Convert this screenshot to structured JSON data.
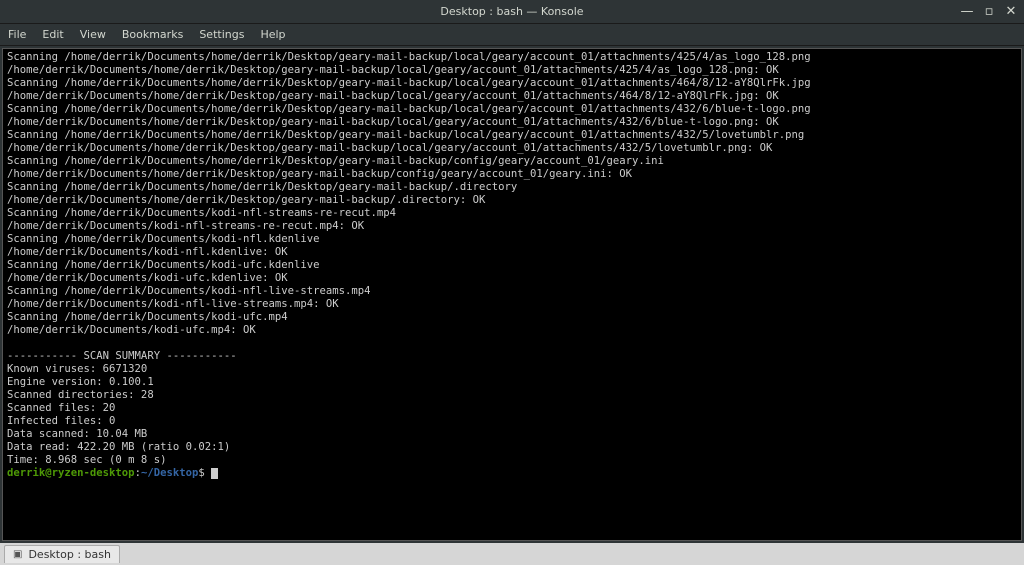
{
  "titlebar": {
    "title": "Desktop : bash — Konsole"
  },
  "window_controls": {
    "minimize": "—",
    "maximize": "▫",
    "close": "✕"
  },
  "menu": {
    "file": "File",
    "edit": "Edit",
    "view": "View",
    "bookmarks": "Bookmarks",
    "settings": "Settings",
    "help": "Help"
  },
  "terminal": {
    "lines": [
      "Scanning /home/derrik/Documents/home/derrik/Desktop/geary-mail-backup/local/geary/account_01/attachments/425/4/as_logo_128.png",
      "/home/derrik/Documents/home/derrik/Desktop/geary-mail-backup/local/geary/account_01/attachments/425/4/as_logo_128.png: OK",
      "Scanning /home/derrik/Documents/home/derrik/Desktop/geary-mail-backup/local/geary/account_01/attachments/464/8/12-aY8QlrFk.jpg",
      "/home/derrik/Documents/home/derrik/Desktop/geary-mail-backup/local/geary/account_01/attachments/464/8/12-aY8QlrFk.jpg: OK",
      "Scanning /home/derrik/Documents/home/derrik/Desktop/geary-mail-backup/local/geary/account_01/attachments/432/6/blue-t-logo.png",
      "/home/derrik/Documents/home/derrik/Desktop/geary-mail-backup/local/geary/account_01/attachments/432/6/blue-t-logo.png: OK",
      "Scanning /home/derrik/Documents/home/derrik/Desktop/geary-mail-backup/local/geary/account_01/attachments/432/5/lovetumblr.png",
      "/home/derrik/Documents/home/derrik/Desktop/geary-mail-backup/local/geary/account_01/attachments/432/5/lovetumblr.png: OK",
      "Scanning /home/derrik/Documents/home/derrik/Desktop/geary-mail-backup/config/geary/account_01/geary.ini",
      "/home/derrik/Documents/home/derrik/Desktop/geary-mail-backup/config/geary/account_01/geary.ini: OK",
      "Scanning /home/derrik/Documents/home/derrik/Desktop/geary-mail-backup/.directory",
      "/home/derrik/Documents/home/derrik/Desktop/geary-mail-backup/.directory: OK",
      "Scanning /home/derrik/Documents/kodi-nfl-streams-re-recut.mp4",
      "/home/derrik/Documents/kodi-nfl-streams-re-recut.mp4: OK",
      "Scanning /home/derrik/Documents/kodi-nfl.kdenlive",
      "/home/derrik/Documents/kodi-nfl.kdenlive: OK",
      "Scanning /home/derrik/Documents/kodi-ufc.kdenlive",
      "/home/derrik/Documents/kodi-ufc.kdenlive: OK",
      "Scanning /home/derrik/Documents/kodi-nfl-live-streams.mp4",
      "/home/derrik/Documents/kodi-nfl-live-streams.mp4: OK",
      "Scanning /home/derrik/Documents/kodi-ufc.mp4",
      "/home/derrik/Documents/kodi-ufc.mp4: OK",
      "",
      "----------- SCAN SUMMARY -----------",
      "Known viruses: 6671320",
      "Engine version: 0.100.1",
      "Scanned directories: 28",
      "Scanned files: 20",
      "Infected files: 0",
      "Data scanned: 10.04 MB",
      "Data read: 422.20 MB (ratio 0.02:1)",
      "Time: 8.968 sec (0 m 8 s)"
    ],
    "prompt": {
      "user": "derrik@ryzen-desktop",
      "separator": ":",
      "path": "~/Desktop",
      "dollar": "$"
    }
  },
  "tab": {
    "label": "Desktop : bash"
  }
}
